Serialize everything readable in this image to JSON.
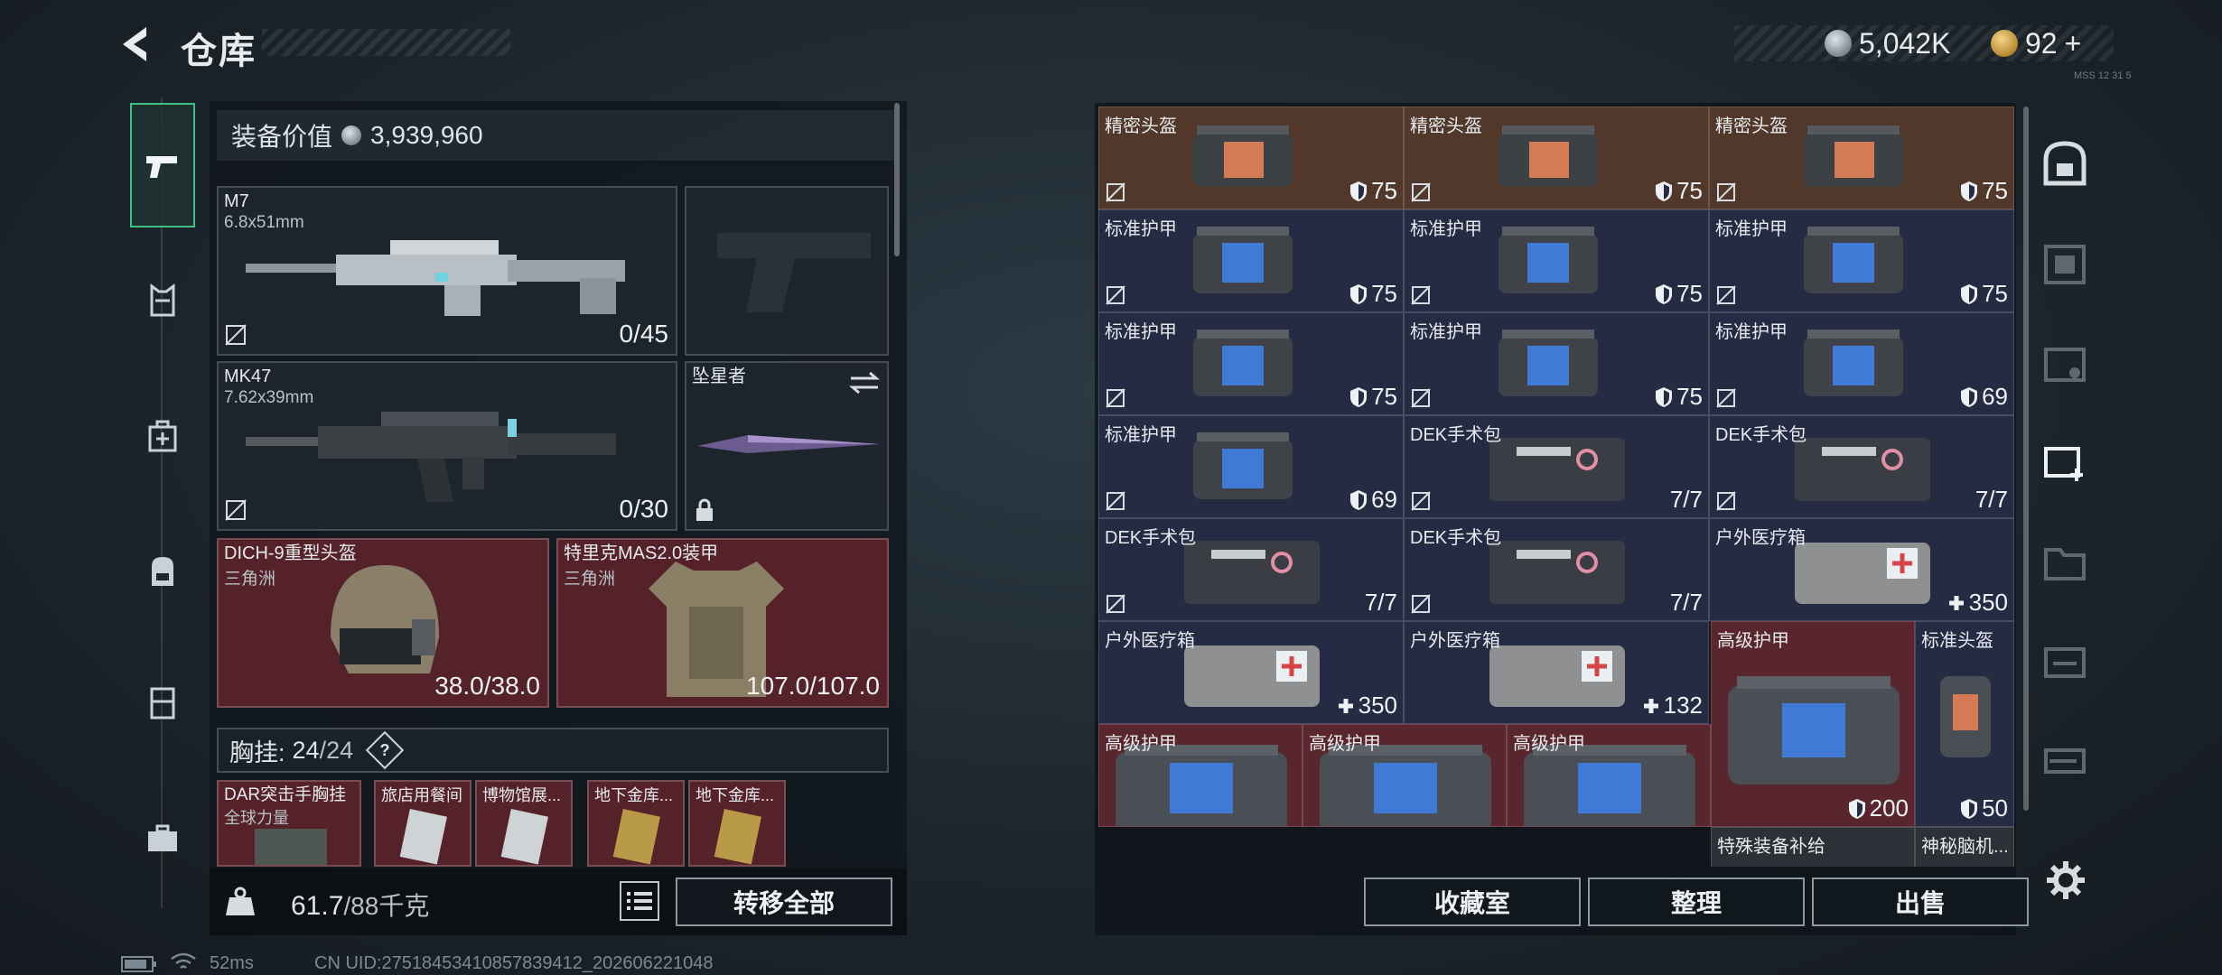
{
  "header": {
    "title": "仓库"
  },
  "currency": {
    "coins": "5,042K",
    "gold": "92",
    "plus": "+",
    "code": "MSS 12 31 5"
  },
  "left_rail": {
    "items": [
      "pistol-icon",
      "vest-icon",
      "medkit-icon",
      "backpack-icon",
      "locker-icon",
      "case-icon"
    ]
  },
  "equipment": {
    "value_label": "装备价值",
    "value": "3,939,960",
    "primary": {
      "name": "M7",
      "caliber": "6.8x51mm",
      "ammo": "0/45"
    },
    "secondary": {
      "name": "MK47",
      "caliber": "7.62x39mm",
      "ammo": "0/30"
    },
    "melee": {
      "name": "坠星者"
    },
    "helmet": {
      "name": "DICH-9重型头盔",
      "faction": "三角洲",
      "durability": "38.0/38.0"
    },
    "armor": {
      "name": "特里克MAS2.0装甲",
      "faction": "三角洲",
      "durability": "107.0/107.0"
    },
    "chest": {
      "label": "胸挂:",
      "used": "24",
      "cap": "/24",
      "help": "?"
    },
    "chest_items": [
      {
        "name": "DAR突击手胸挂",
        "sub": "全球力量"
      },
      {
        "name": "旅店用餐间"
      },
      {
        "name": "博物馆展..."
      },
      {
        "name": "地下金库..."
      },
      {
        "name": "地下金库..."
      }
    ]
  },
  "bottom": {
    "weight": "61.7",
    "weight_cap": "/88千克",
    "transfer_all": "转移全部"
  },
  "grid": {
    "cells": [
      {
        "label": "精密头盔",
        "value": "75",
        "kind": "shield"
      },
      {
        "label": "精密头盔",
        "value": "75",
        "kind": "shield"
      },
      {
        "label": "精密头盔",
        "value": "75",
        "kind": "shield"
      },
      {
        "label": "标准护甲",
        "value": "75",
        "kind": "shield"
      },
      {
        "label": "标准护甲",
        "value": "75",
        "kind": "shield"
      },
      {
        "label": "标准护甲",
        "value": "75",
        "kind": "shield"
      },
      {
        "label": "标准护甲",
        "value": "75",
        "kind": "shield"
      },
      {
        "label": "标准护甲",
        "value": "75",
        "kind": "shield"
      },
      {
        "label": "标准护甲",
        "value": "69",
        "kind": "shield"
      },
      {
        "label": "标准护甲",
        "value": "69",
        "kind": "shield"
      },
      {
        "label": "DEK手术包",
        "value": "7/7",
        "kind": "count"
      },
      {
        "label": "DEK手术包",
        "value": "7/7",
        "kind": "count"
      },
      {
        "label": "DEK手术包",
        "value": "7/7",
        "kind": "count"
      },
      {
        "label": "DEK手术包",
        "value": "7/7",
        "kind": "count"
      },
      {
        "label": "户外医疗箱",
        "value": "350",
        "kind": "heal"
      },
      {
        "label": "户外医疗箱",
        "value": "350",
        "kind": "heal"
      },
      {
        "label": "户外医疗箱",
        "value": "132",
        "kind": "heal"
      },
      {
        "label": "高级护甲",
        "value": "200",
        "kind": "shield"
      },
      {
        "label": "标准头盔",
        "value": "50",
        "kind": "shield"
      },
      {
        "label": "高级护甲",
        "value": "",
        "kind": "none"
      },
      {
        "label": "高级护甲",
        "value": "",
        "kind": "none"
      },
      {
        "label": "高级护甲",
        "value": "",
        "kind": "none"
      },
      {
        "label": "特殊装备补给",
        "value": "",
        "kind": "none"
      },
      {
        "label": "神秘脑机...",
        "value": "",
        "kind": "none"
      }
    ]
  },
  "actions": {
    "collection": "收藏室",
    "organize": "整理",
    "sell": "出售"
  },
  "status": {
    "ping": "52ms",
    "uid": "CN UID:2751845341085783941​2_20260622104​8"
  }
}
